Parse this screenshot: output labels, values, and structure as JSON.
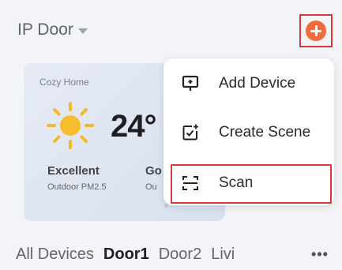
{
  "header": {
    "home_name": "IP Door",
    "home_dropdown_icon": "caret-down-icon",
    "add_icon": "plus-circle-icon",
    "accent_color": "#f16a3a"
  },
  "weather": {
    "title": "Cozy Home",
    "icon": "sun-icon",
    "temperature": "24°",
    "metric1_value": "Excellent",
    "metric1_label": "Outdoor PM2.5",
    "metric2_value": "Go",
    "metric2_label": "Ou"
  },
  "menu": {
    "items": [
      {
        "label": "Add Device",
        "icon": "add-device-icon"
      },
      {
        "label": "Create Scene",
        "icon": "create-scene-icon"
      },
      {
        "label": "Scan",
        "icon": "scan-icon"
      }
    ]
  },
  "tabs": {
    "items": [
      "All Devices",
      "Door1",
      "Door2",
      "Livi"
    ],
    "active": "Door1",
    "more_label": "•••"
  }
}
